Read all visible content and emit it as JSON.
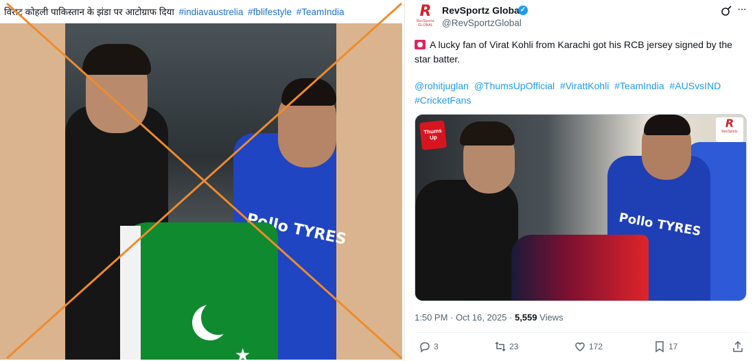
{
  "left": {
    "caption_text": "विराट कोहली पाकिस्तान के झंडा पर आटोग्राफ दिया",
    "hashtags": [
      "#indiavaustrelia",
      "#fblifestyle",
      "#TeamIndia"
    ],
    "flag_colors": {
      "green": "#0f8a2e",
      "white": "#ffffff"
    },
    "cross_color": "#f08a2b",
    "photo_sponsor_text": "Pollo TYRES"
  },
  "tweet": {
    "author_name": "RevSportz Global",
    "author_handle": "@RevSportzGlobal",
    "avatar_letter": "R",
    "avatar_sub": "RevSportz GLOBAL",
    "text": "A lucky fan of Virat Kohli from Karachi got his RCB jersey signed by the star batter.",
    "mentions_and_tags": [
      "@rohitjuglan",
      "@ThumsUpOfficial",
      "#VirattKohli",
      "#TeamIndia",
      "#AUSvsIND",
      "#CricketFans"
    ],
    "media": {
      "left_badge_text": "Thums Up",
      "right_badge_letter": "R",
      "right_badge_sub": "RevSportz",
      "sponsor_text": "Pollo TYRES"
    },
    "timestamp": "1:50 PM · Oct 16, 2025 · ",
    "views_count": "5,559",
    "views_label": " Views",
    "actions": {
      "replies": "3",
      "reposts": "23",
      "likes": "172",
      "bookmarks": "17"
    },
    "accent_color": "#1d9bf0"
  }
}
